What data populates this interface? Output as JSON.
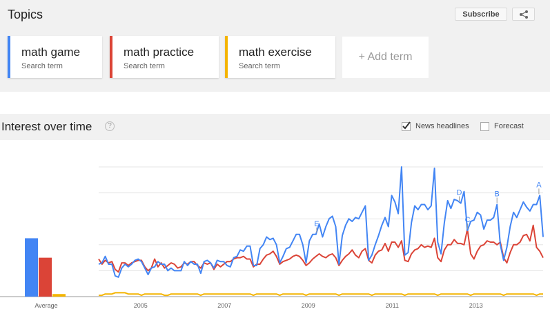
{
  "topics": {
    "title": "Topics",
    "subscribe_label": "Subscribe",
    "share_icon": "share-icon",
    "terms": [
      {
        "name": "math game",
        "sub": "Search term",
        "color": "#4285f4"
      },
      {
        "name": "math practice",
        "sub": "Search term",
        "color": "#db4437"
      },
      {
        "name": "math exercise",
        "sub": "Search term",
        "color": "#f4b400"
      }
    ],
    "add_term_label": "+ Add term"
  },
  "interest": {
    "title": "Interest over time",
    "help_icon": "help-icon",
    "help_glyph": "?",
    "news_headlines_label": "News headlines",
    "news_headlines_checked": true,
    "forecast_label": "Forecast",
    "forecast_checked": false
  },
  "chart_data": {
    "type": "line",
    "x_tick_labels": [
      "2005",
      "2007",
      "2009",
      "2011",
      "2013"
    ],
    "x_range": [
      2004.0,
      2014.6
    ],
    "y_range": [
      0,
      100
    ],
    "grid": true,
    "average": {
      "label": "Average",
      "values": [
        45,
        30,
        2
      ]
    },
    "annotations": [
      {
        "label": "E",
        "series": 0,
        "x": 2009.2
      },
      {
        "label": "D",
        "series": 0,
        "x": 2012.6
      },
      {
        "label": "C",
        "series": 0,
        "x": 2012.8
      },
      {
        "label": "B",
        "series": 0,
        "x": 2013.5
      },
      {
        "label": "A",
        "series": 0,
        "x": 2014.5
      }
    ],
    "series": [
      {
        "name": "math game",
        "color": "#4285f4",
        "values": [
          25,
          26,
          31,
          25,
          25,
          16,
          15,
          22,
          25,
          23,
          25,
          28,
          29,
          27,
          22,
          17,
          22,
          23,
          27,
          25,
          25,
          20,
          22,
          20,
          20,
          20,
          27,
          24,
          27,
          25,
          25,
          18,
          27,
          28,
          26,
          22,
          28,
          27,
          27,
          24,
          23,
          30,
          31,
          36,
          35,
          39,
          39,
          24,
          24,
          37,
          40,
          46,
          44,
          45,
          40,
          26,
          31,
          37,
          38,
          43,
          48,
          48,
          40,
          26,
          43,
          48,
          48,
          56,
          46,
          54,
          60,
          62,
          54,
          25,
          47,
          55,
          60,
          58,
          61,
          60,
          65,
          70,
          28,
          32,
          40,
          47,
          55,
          61,
          54,
          78,
          73,
          64,
          100,
          32,
          34,
          57,
          70,
          67,
          71,
          71,
          67,
          70,
          99,
          42,
          33,
          57,
          74,
          68,
          75,
          74,
          72,
          81,
          51,
          58,
          59,
          65,
          63,
          52,
          59,
          59,
          61,
          71,
          40,
          28,
          38,
          54,
          65,
          61,
          67,
          73,
          69,
          66,
          71,
          71,
          78,
          46
        ]
      },
      {
        "name": "math practice",
        "color": "#db4437",
        "values": [
          29,
          25,
          28,
          26,
          27,
          21,
          19,
          26,
          26,
          24,
          26,
          27,
          28,
          28,
          23,
          20,
          22,
          29,
          23,
          26,
          22,
          24,
          26,
          25,
          22,
          23,
          26,
          25,
          27,
          27,
          24,
          22,
          26,
          25,
          26,
          21,
          25,
          23,
          25,
          27,
          27,
          29,
          30,
          30,
          31,
          29,
          29,
          23,
          25,
          25,
          29,
          32,
          33,
          35,
          31,
          25,
          27,
          28,
          29,
          31,
          32,
          31,
          28,
          24,
          26,
          29,
          31,
          33,
          31,
          30,
          32,
          33,
          30,
          24,
          28,
          31,
          33,
          36,
          32,
          30,
          35,
          37,
          28,
          26,
          32,
          35,
          36,
          41,
          35,
          42,
          42,
          38,
          43,
          28,
          27,
          33,
          36,
          37,
          40,
          38,
          39,
          38,
          45,
          30,
          27,
          36,
          40,
          40,
          44,
          41,
          41,
          40,
          52,
          33,
          29,
          35,
          39,
          40,
          43,
          42,
          42,
          40,
          42,
          30,
          26,
          34,
          40,
          40,
          42,
          47,
          48,
          43,
          55,
          38,
          35,
          30
        ]
      },
      {
        "name": "math exercise",
        "color": "#f4b400",
        "values": [
          1,
          1,
          2,
          2,
          2,
          3,
          3,
          3,
          3,
          2,
          2,
          2,
          2,
          1,
          2,
          2,
          2,
          2,
          2,
          2,
          1,
          1,
          2,
          2,
          2,
          2,
          2,
          2,
          2,
          2,
          2,
          1,
          2,
          2,
          2,
          2,
          2,
          2,
          2,
          2,
          2,
          2,
          2,
          2,
          2,
          2,
          2,
          1,
          2,
          2,
          2,
          2,
          2,
          2,
          2,
          1,
          2,
          2,
          2,
          2,
          2,
          2,
          2,
          1,
          2,
          2,
          2,
          2,
          2,
          2,
          2,
          2,
          2,
          1,
          2,
          2,
          2,
          2,
          2,
          2,
          2,
          2,
          2,
          1,
          2,
          2,
          2,
          2,
          2,
          2,
          2,
          2,
          2,
          1,
          2,
          2,
          2,
          2,
          2,
          2,
          2,
          2,
          2,
          1,
          2,
          2,
          2,
          2,
          2,
          2,
          2,
          2,
          2,
          1,
          2,
          2,
          2,
          2,
          2,
          2,
          2,
          2,
          2,
          1,
          2,
          2,
          2,
          2,
          2,
          2,
          2,
          2,
          2,
          1,
          2,
          2
        ]
      }
    ]
  }
}
